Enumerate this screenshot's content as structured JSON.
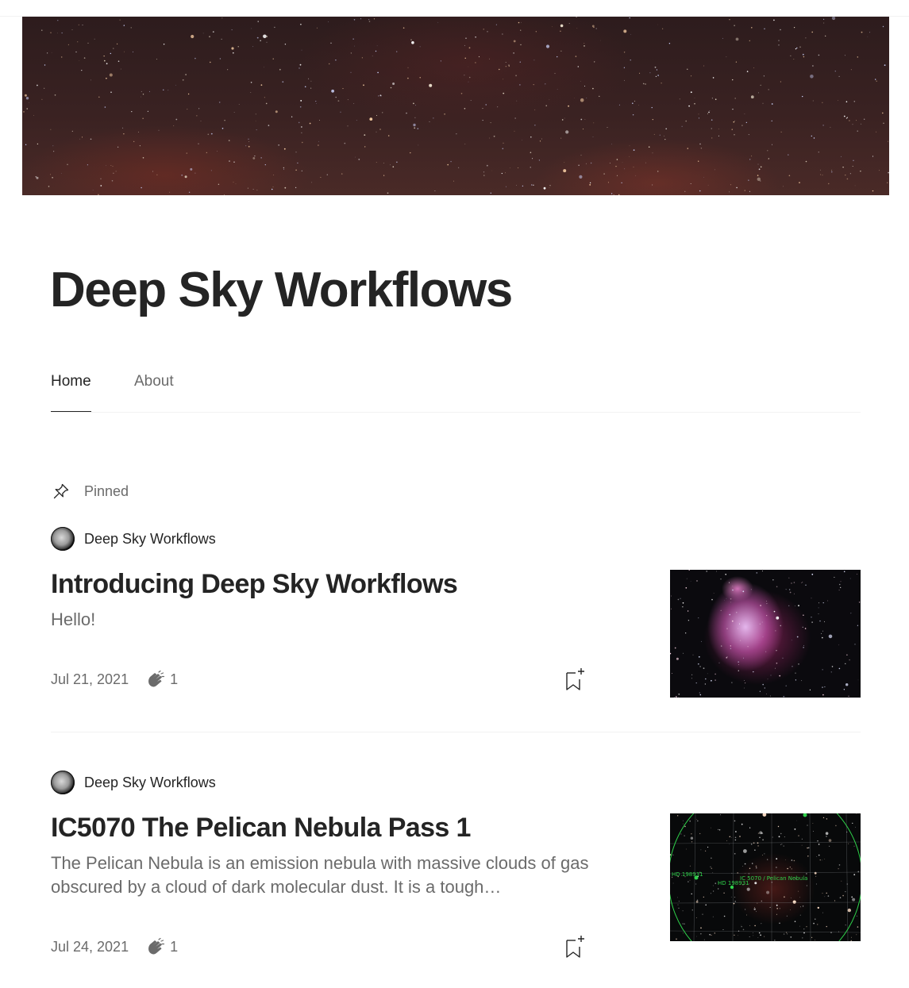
{
  "publication": {
    "title": "Deep Sky Workflows"
  },
  "nav": {
    "tabs": [
      {
        "label": "Home",
        "active": true
      },
      {
        "label": "About",
        "active": false
      }
    ]
  },
  "pinned_label": "Pinned",
  "posts": [
    {
      "author": "Deep Sky Workflows",
      "title": "Introducing Deep Sky Workflows",
      "subtitle": "Hello!",
      "date": "Jul 21, 2021",
      "claps": "1",
      "thumbnail": "orion-nebula-image"
    },
    {
      "author": "Deep Sky Workflows",
      "title": "IC5070 The Pelican Nebula Pass 1",
      "subtitle": "The Pelican Nebula is an emission nebula with massive clouds of gas obscured by a cloud of dark molecular dust. It is a tough…",
      "date": "Jul 24, 2021",
      "claps": "1",
      "thumbnail": "pelican-nebula-plate-solve-image",
      "thumbnail_labels": [
        "HD 198931",
        "IC 5070 / Pelican Nebula",
        "HD 198931"
      ]
    }
  ],
  "colors": {
    "text_primary": "#242424",
    "text_secondary": "#6b6b6b",
    "divider": "#f2f2f2",
    "annotation_green": "#2fd04a"
  },
  "icons": [
    "pin-icon",
    "clap-icon",
    "bookmark-add-icon"
  ]
}
